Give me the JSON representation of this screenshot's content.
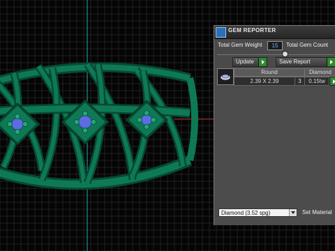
{
  "viewport": {
    "background": "#050505",
    "grid_color": "#3a3a3a",
    "axis_y_color": "#20b0b0",
    "axis_x_color": "#c02020",
    "ring_color": "#0e7a55",
    "gem_color": "#5a6ee0"
  },
  "panel": {
    "title": "GEM REPORTER",
    "app_icon_text": "",
    "total_gem_weight_label": "Total Gem Weight",
    "total_gem_weight_value": "15",
    "total_gem_count_label": "Total Gem Count",
    "update_label": "Update",
    "save_report_label": "Save Report",
    "table": {
      "headers": [
        "Round",
        "Diamond"
      ],
      "row": {
        "size": "2.39 X 2.39",
        "count": "3",
        "weight": "0.15tw"
      }
    },
    "material_select": "Diamond   (3.52 spg)",
    "set_material_label": "Set Material",
    "accent_green": "#2e8b2e"
  }
}
